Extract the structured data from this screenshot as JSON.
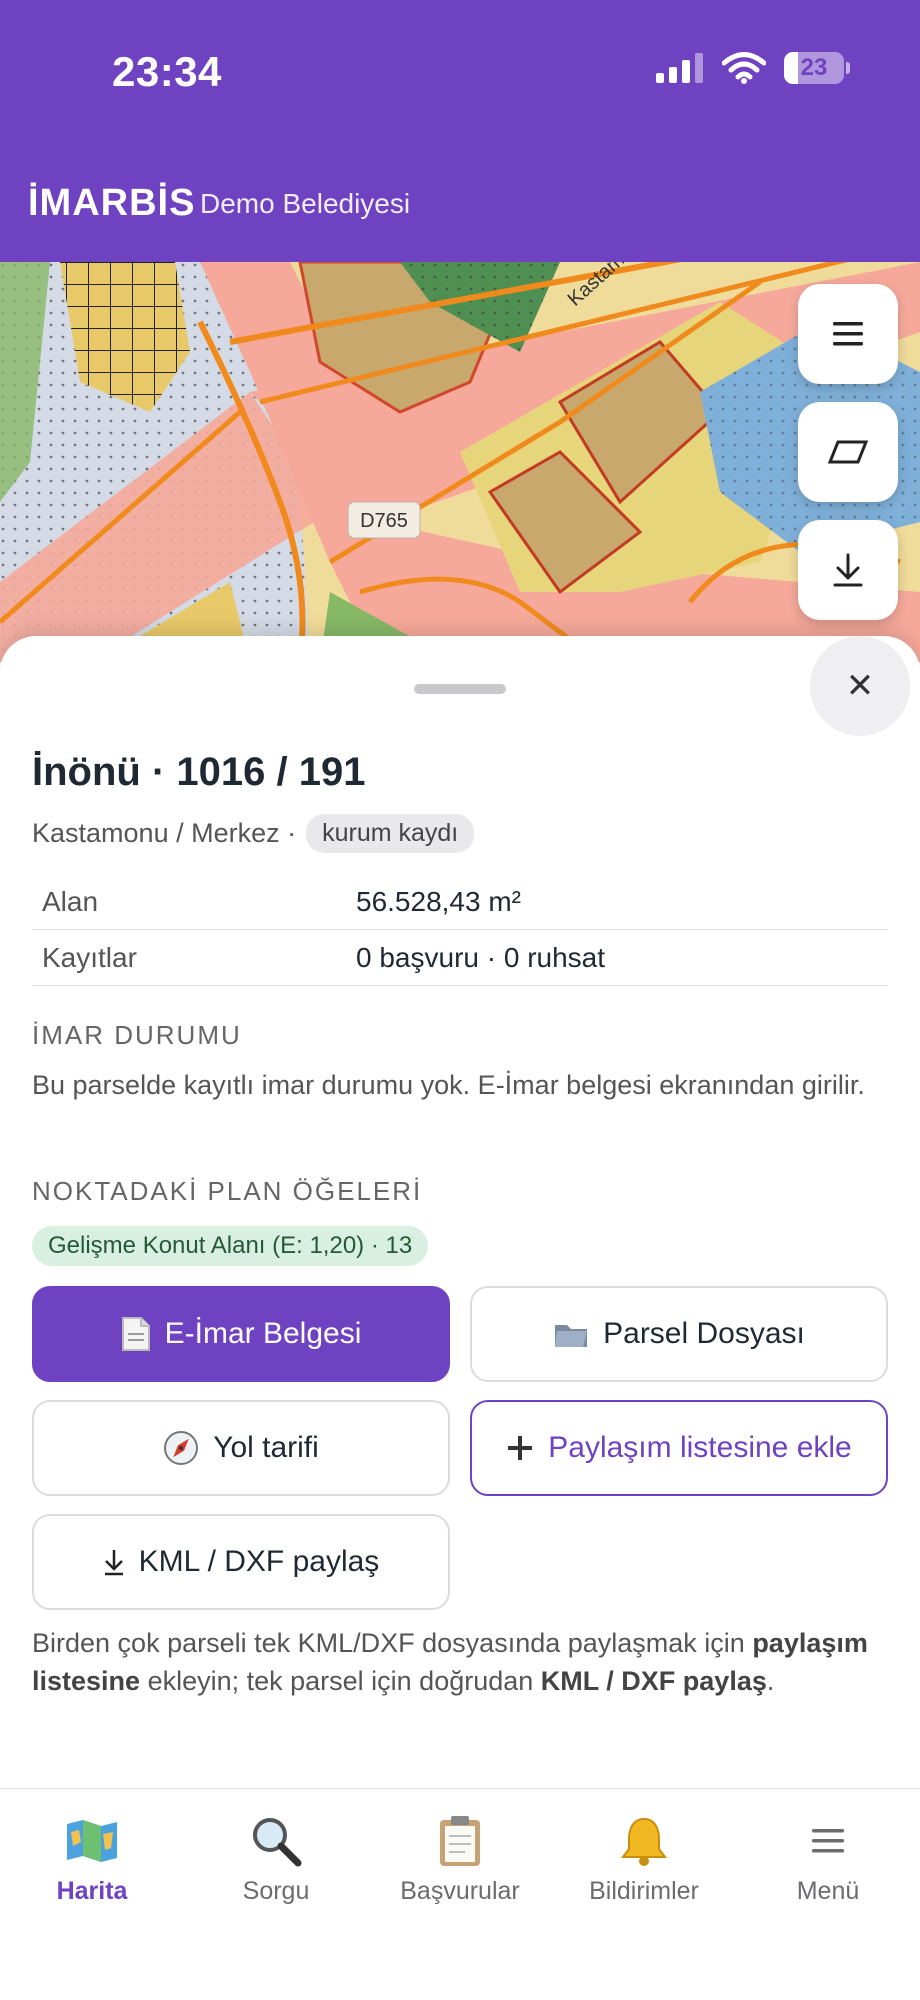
{
  "status_bar": {
    "time": "23:34",
    "battery": "23"
  },
  "header": {
    "app_title": "İMARBİS",
    "subtitle": "Demo Belediyesi"
  },
  "map": {
    "road_label": "D765",
    "street_label": "Kastamonu"
  },
  "parcel": {
    "title": "İnönü · 1016 / 191",
    "location": "Kastamonu / Merkez ·",
    "tag": "kurum kaydı",
    "rows": [
      {
        "key": "Alan",
        "value": "56.528,43 m²"
      },
      {
        "key": "Kayıtlar",
        "value": "0 başvuru · 0 ruhsat"
      }
    ]
  },
  "imar": {
    "title": "İMAR DURUMU",
    "text": "Bu parselde kayıtlı imar durumu yok. E-İmar belgesi ekranından girilir."
  },
  "plan": {
    "title": "NOKTADAKİ PLAN ÖĞELERİ",
    "chip": "Gelişme Konut Alanı (E: 1,20) · 13"
  },
  "actions": {
    "eimar": "E-İmar Belgesi",
    "parcel_file": "Parsel Dosyası",
    "directions": "Yol tarifi",
    "add_share": "Paylaşım listesine ekle",
    "kml": "KML / DXF paylaş"
  },
  "footnote": {
    "part1": "Birden çok parseli tek KML/DXF dosyasında paylaşmak için ",
    "bold1": "paylaşım listesine",
    "part2": " ekleyin; tek parsel için doğrudan ",
    "bold2": "KML / DXF paylaş",
    "part3": "."
  },
  "tabs": [
    {
      "label": "Harita",
      "icon": "map-icon"
    },
    {
      "label": "Sorgu",
      "icon": "magnifier-icon"
    },
    {
      "label": "Başvurular",
      "icon": "clipboard-icon"
    },
    {
      "label": "Bildirimler",
      "icon": "bell-icon"
    },
    {
      "label": "Menü",
      "icon": "menu-icon"
    }
  ],
  "colors": {
    "accent": "#6f42c1",
    "chip_bg": "#d9efe1",
    "chip_text": "#24593a"
  }
}
